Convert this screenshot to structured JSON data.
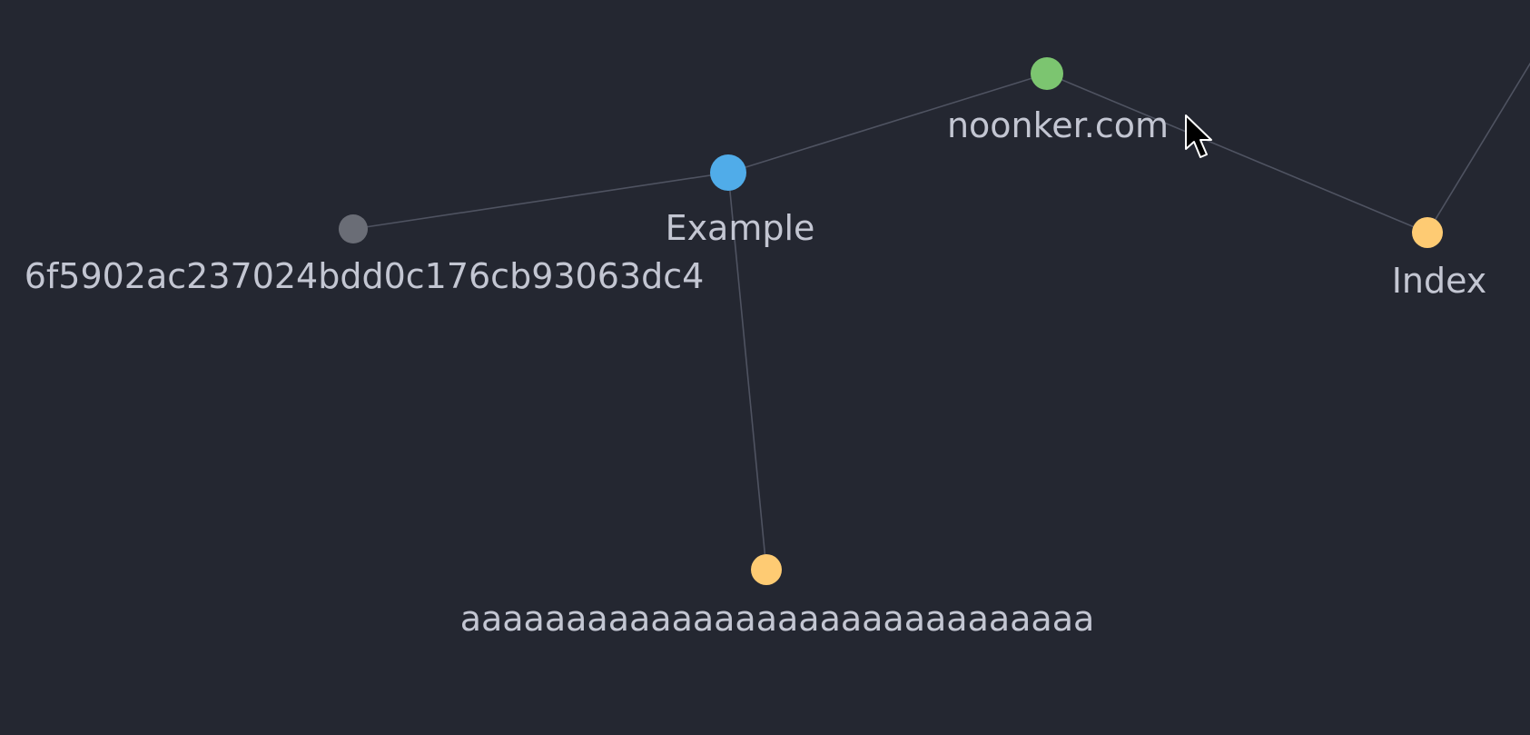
{
  "graph": {
    "nodes": [
      {
        "id": "n-example",
        "label": "Example",
        "color": "#50ace9"
      },
      {
        "id": "n-noonker",
        "label": "noonker.com",
        "color": "#7cc570"
      },
      {
        "id": "n-hash",
        "label": "6f5902ac237024bdd0c176cb93063dc4",
        "color": "#6a6d76"
      },
      {
        "id": "n-index",
        "label": "Index",
        "color": "#fecb73"
      },
      {
        "id": "n-aaaa",
        "label": "aaaaaaaaaaaaaaaaaaaaaaaaaaaaaa",
        "color": "#fecb73"
      }
    ],
    "edges": [
      {
        "from": "n-hash",
        "to": "n-example"
      },
      {
        "from": "n-example",
        "to": "n-noonker"
      },
      {
        "from": "n-noonker",
        "to": "n-index"
      },
      {
        "from": "n-example",
        "to": "n-aaaa"
      },
      {
        "from": "n-index",
        "to": "offscreen-top-right"
      }
    ]
  },
  "colors": {
    "background": "#242731",
    "edge": "#4f5361",
    "label": "#c3c6d2"
  },
  "cursor": {
    "icon": "mouse-pointer-icon"
  }
}
